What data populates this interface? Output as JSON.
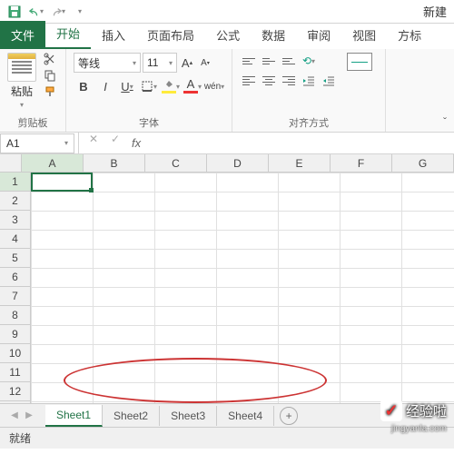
{
  "qat": {
    "title_right": "新建"
  },
  "tabs": {
    "file": "文件",
    "items": [
      "开始",
      "插入",
      "页面布局",
      "公式",
      "数据",
      "审阅",
      "视图",
      "方标"
    ],
    "active_index": 0
  },
  "ribbon": {
    "clipboard": {
      "paste": "粘贴",
      "group_label": "剪贴板"
    },
    "font": {
      "name": "等线",
      "size": "11",
      "grow": "A",
      "shrink": "A",
      "bold": "B",
      "italic": "I",
      "underline": "U",
      "wen": "wén",
      "group_label": "字体"
    },
    "alignment": {
      "group_label": "对齐方式"
    }
  },
  "namebox": "A1",
  "formula_fx": "fx",
  "columns": [
    "A",
    "B",
    "C",
    "D",
    "E",
    "F",
    "G"
  ],
  "rows": [
    "1",
    "2",
    "3",
    "4",
    "5",
    "6",
    "7",
    "8",
    "9",
    "10",
    "11",
    "12"
  ],
  "sheets": [
    "Sheet1",
    "Sheet2",
    "Sheet3",
    "Sheet4"
  ],
  "active_sheet_index": 0,
  "status": "就绪",
  "watermark": {
    "brand": "经验啦",
    "url": "jingyanla.com"
  }
}
